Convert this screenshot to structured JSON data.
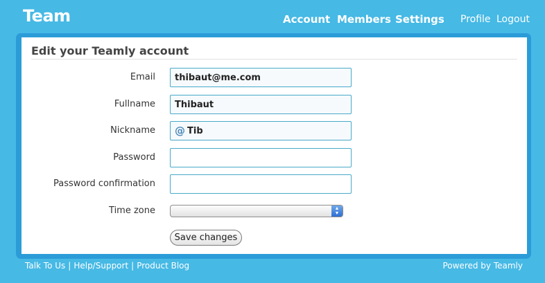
{
  "header": {
    "brand": "Team",
    "main_nav": [
      "Account",
      "Members",
      "Settings"
    ],
    "user_nav": [
      "Profile",
      "Logout"
    ]
  },
  "form": {
    "title": "Edit your Teamly account",
    "fields": {
      "email": {
        "label": "Email",
        "value": "thibaut@me.com"
      },
      "fullname": {
        "label": "Fullname",
        "value": "Thibaut"
      },
      "nickname": {
        "label": "Nickname",
        "prefix": "@",
        "value": "Tib"
      },
      "password": {
        "label": "Password",
        "value": ""
      },
      "password_confirmation": {
        "label": "Password confirmation",
        "value": ""
      },
      "time_zone": {
        "label": "Time zone",
        "value": ""
      }
    },
    "save_label": "Save changes"
  },
  "footer": {
    "links": [
      "Talk To Us",
      "Help/Support",
      "Product Blog"
    ],
    "separator": "|",
    "powered_by": "Powered by Teamly"
  },
  "colors": {
    "background": "#46b9e5",
    "panel_border": "#2c9cd8",
    "field_border": "#47a9c9"
  }
}
